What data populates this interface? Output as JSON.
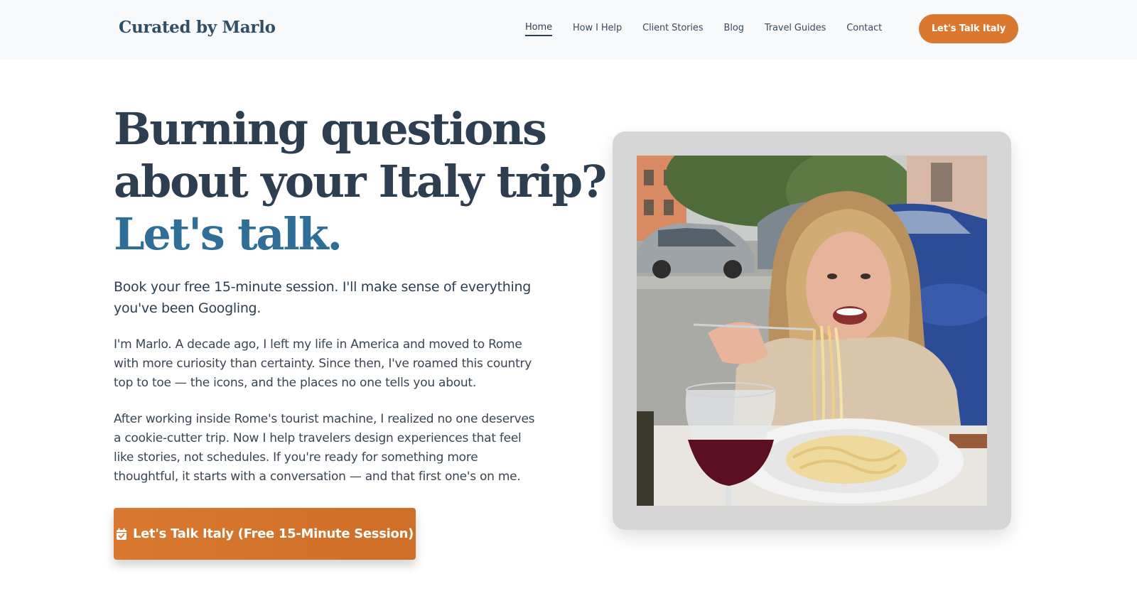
{
  "header": {
    "brand": "Curated by Marlo",
    "nav": [
      {
        "label": "Home",
        "active": true
      },
      {
        "label": "How I Help"
      },
      {
        "label": "Client Stories"
      },
      {
        "label": "Blog"
      },
      {
        "label": "Travel Guides"
      },
      {
        "label": "Contact"
      }
    ],
    "cta_label": "Let's Talk Italy"
  },
  "hero": {
    "title_line1": "Burning questions",
    "title_line2": "about your Italy trip?",
    "title_line3": "Let's talk.",
    "subtitle": "Book your free 15-minute session. I'll make sense of everything you've been Googling.",
    "paragraph1": "I'm Marlo. A decade ago, I left my life in America and moved to Rome with more curiosity than certainty. Since then, I've roamed this country top to toe — the icons, and the places no one tells you about.",
    "paragraph2": "After working inside Rome's tourist machine, I realized no one deserves a cookie-cutter trip. Now I help travelers design experiences that feel like stories, not schedules. If you're ready for something more thoughtful, it starts with a conversation — and that first one's on me.",
    "cta_label": "Let's Talk Italy (Free 15-Minute Session)",
    "cta_icon": "calendar-check-icon"
  },
  "photo": {
    "subject": "woman-eating-spaghetti-photo"
  },
  "colors": {
    "accent_orange": "#d9782e",
    "heading_navy": "#2c3e50",
    "accent_blue": "#2f6e96",
    "header_bg": "#f8f9fb",
    "card_bg": "#d6d6d6"
  }
}
